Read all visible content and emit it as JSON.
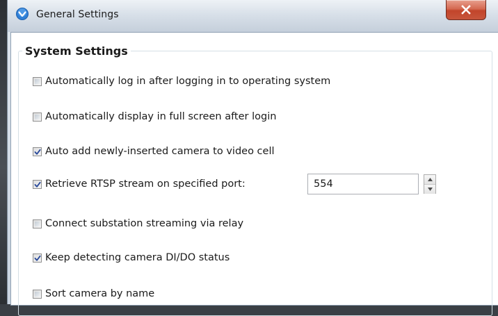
{
  "window": {
    "title": "General Settings",
    "app_icon": "app-logo-icon",
    "close_icon": "close-icon"
  },
  "group": {
    "title": "System Settings"
  },
  "options": [
    {
      "label": "Automatically log in after logging in to operating system",
      "checked": false
    },
    {
      "label": "Automatically display in full screen after login",
      "checked": false
    },
    {
      "label": "Auto add newly-inserted camera to video cell",
      "checked": true
    },
    {
      "label": "Retrieve RTSP stream on specified port:",
      "checked": true
    },
    {
      "label": "Connect substation streaming via relay",
      "checked": false
    },
    {
      "label": "Keep detecting camera DI/DO status",
      "checked": true
    },
    {
      "label": "Sort camera by name",
      "checked": false
    }
  ],
  "rtsp_port": {
    "value": "554"
  },
  "colors": {
    "check_mark": "#2a4a9a",
    "close_button": "#c7553b"
  }
}
